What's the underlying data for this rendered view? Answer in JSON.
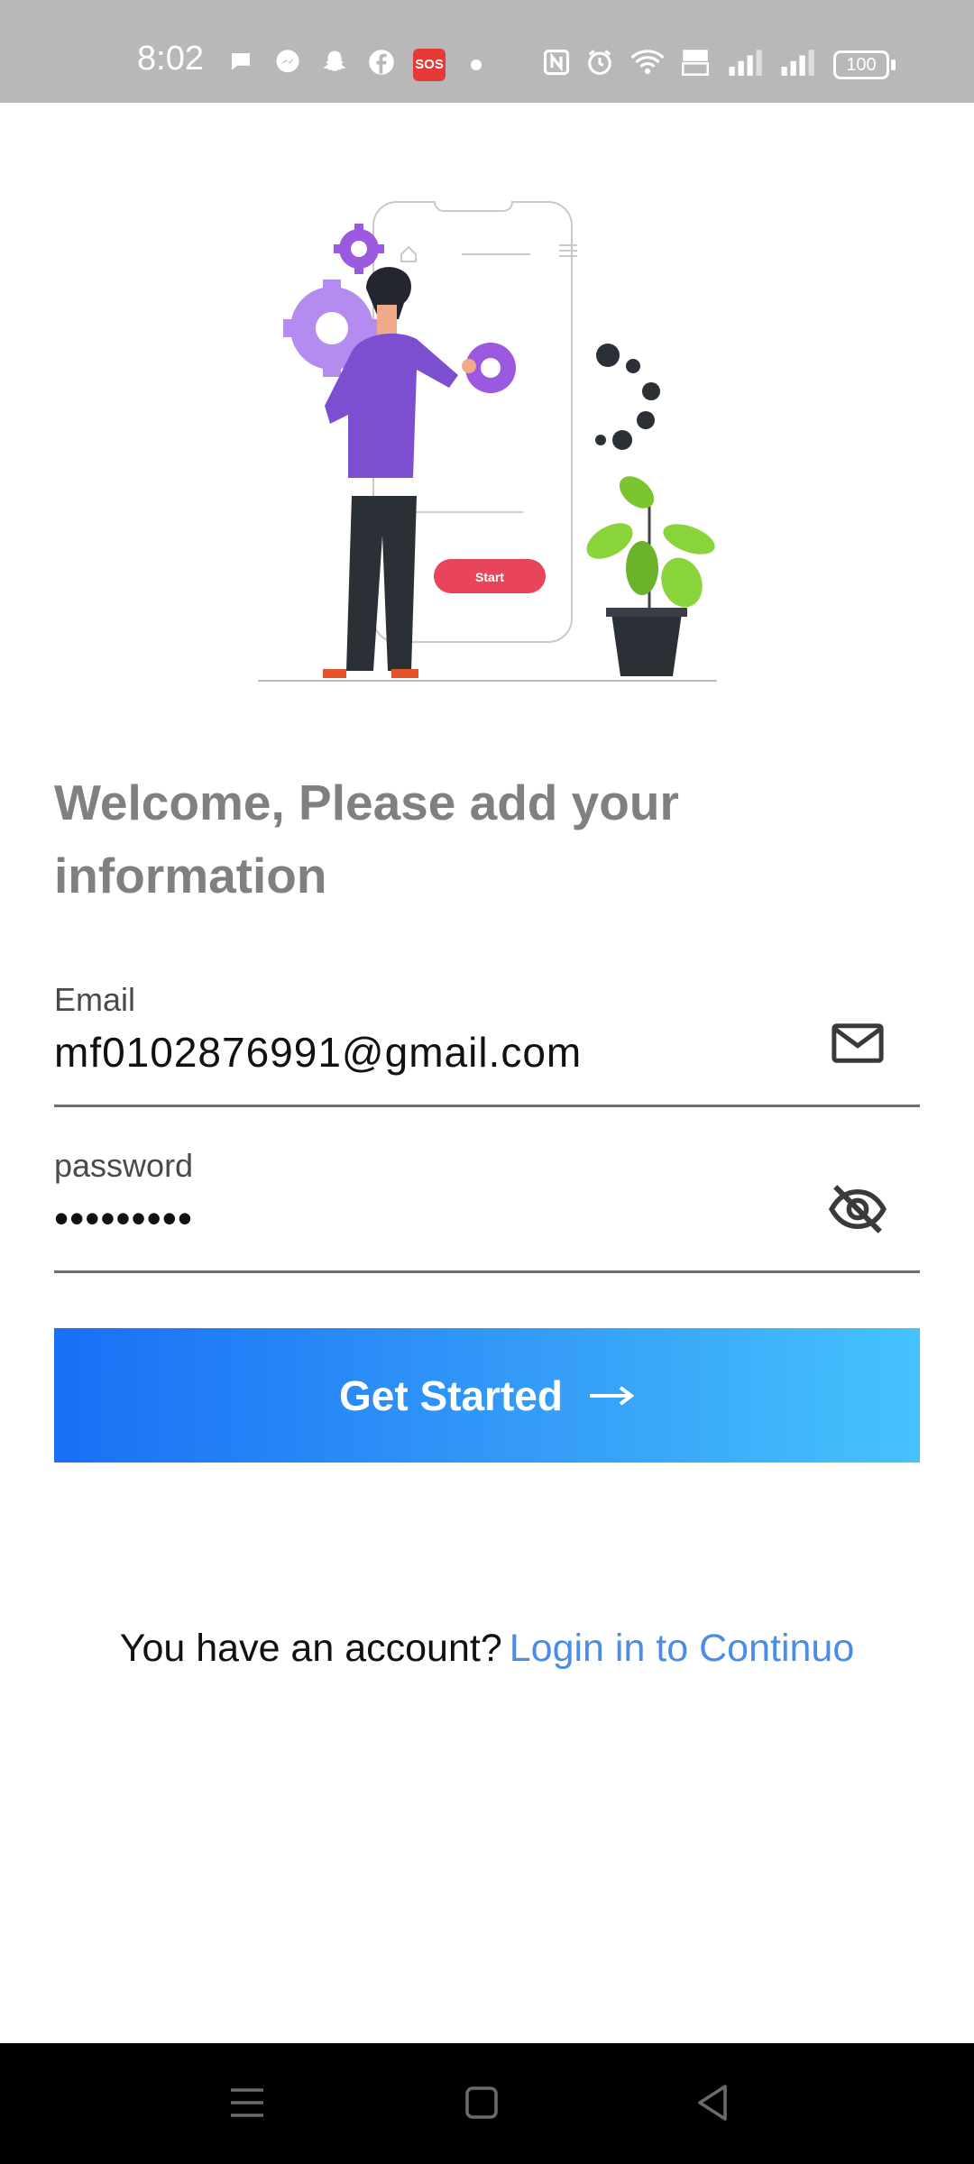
{
  "status_bar": {
    "time": "8:02",
    "sos_label": "SOS",
    "battery_level": "100",
    "left_icons": [
      "message-icon",
      "messenger-icon",
      "snapchat-icon",
      "facebook-icon",
      "sos-icon",
      "dot-icon"
    ],
    "right_icons": [
      "nfc-icon",
      "alarm-icon",
      "wifi-icon",
      "volte-icon",
      "signal-icon",
      "signal-icon",
      "battery-icon"
    ]
  },
  "illustration": {
    "phone_button_label": "Start"
  },
  "main": {
    "welcome_title": "Welcome, Please add your information"
  },
  "form": {
    "email": {
      "label": "Email",
      "value": "mf0102876991@gmail.com",
      "icon": "mail-icon"
    },
    "password": {
      "label": "password",
      "value": "•••••••••",
      "icon": "eye-off-icon"
    }
  },
  "cta": {
    "label": "Get Started",
    "icon": "arrow-right-icon"
  },
  "footer": {
    "prompt": "You have an account?",
    "link": "Login in to Continuo"
  },
  "nav_bar": {
    "buttons": [
      "menu-icon",
      "home-icon",
      "back-icon"
    ]
  },
  "colors": {
    "accent_start": "#1a6ff5",
    "accent_end": "#45c3fd",
    "link": "#4a8de8",
    "heading": "#808080",
    "illustration_purple": "#7b4fcf",
    "illustration_button": "#e8455b"
  }
}
